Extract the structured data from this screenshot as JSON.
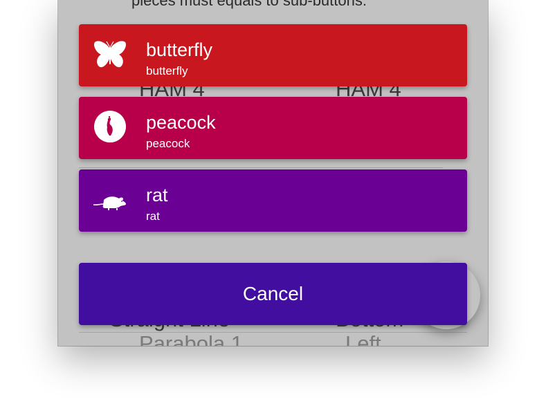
{
  "background": {
    "hint_text": "pieces must equals to sub-buttons:",
    "picker_left_top": "HAM 4",
    "picker_right_top": "HAM 4",
    "picker_left_selected": "Straight Line",
    "picker_right_selected": "Bottom",
    "picker_left_next": "Parabola 1",
    "picker_right_next": "Left"
  },
  "actions": [
    {
      "title": "butterfly",
      "subtitle": "butterfly",
      "icon": "butterfly-icon",
      "color": "#c8171f"
    },
    {
      "title": "peacock",
      "subtitle": "peacock",
      "icon": "peacock-icon",
      "color": "#b8004a"
    },
    {
      "title": "rat",
      "subtitle": "rat",
      "icon": "rat-icon",
      "color": "#6a0094"
    }
  ],
  "cancel": {
    "label": "Cancel",
    "color": "#420ea0"
  },
  "colors": {
    "overlay_bg": "#c2c2c2"
  }
}
